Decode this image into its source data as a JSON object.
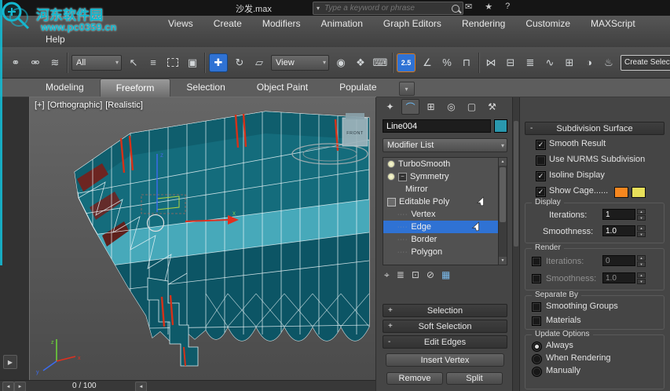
{
  "watermark": {
    "site_name": "河东软件园",
    "site_url": "www.pc0359.cn"
  },
  "title_bar": {
    "document_title": "沙发.max",
    "search_placeholder": "Type a keyword or phrase",
    "right_icons": [
      {
        "name": "communication-center-icon",
        "glyph": "✉"
      },
      {
        "name": "favorites-icon",
        "glyph": "★"
      },
      {
        "name": "help-icon",
        "glyph": "?"
      }
    ]
  },
  "menu": {
    "row1": [
      "Views",
      "Create",
      "Modifiers",
      "Animation",
      "Graph Editors",
      "Rendering",
      "Customize",
      "MAXScript"
    ],
    "row2": [
      "Help"
    ]
  },
  "toolbar": {
    "selection_filter_value": "All",
    "coordinate_system_value": "View",
    "snap_toggle_value": "2.5",
    "create_selection_set_label": "Create Selection S",
    "icons": [
      {
        "name": "select-and-link-icon",
        "glyph": "⚭"
      },
      {
        "name": "unlink-selection-icon",
        "glyph": "⚮"
      },
      {
        "name": "bind-to-space-warp-icon",
        "glyph": "≋"
      },
      {
        "name": "select-object-icon",
        "glyph": "↖"
      },
      {
        "name": "select-by-name-icon",
        "glyph": "≡"
      },
      {
        "name": "rectangular-selection-region-icon",
        "glyph": ""
      },
      {
        "name": "window-crossing-toggle-icon",
        "glyph": "▣"
      },
      {
        "name": "select-and-move-icon",
        "glyph": "✚",
        "active": true
      },
      {
        "name": "select-and-rotate-icon",
        "glyph": "↻"
      },
      {
        "name": "select-and-uniform-scale-icon",
        "glyph": "▱"
      },
      {
        "name": "use-pivot-point-center-icon",
        "glyph": "◉"
      },
      {
        "name": "select-and-manipulate-icon",
        "glyph": "❖"
      },
      {
        "name": "keyboard-shortcut-override-icon",
        "glyph": "⌨"
      },
      {
        "name": "angle-snap-toggle-icon",
        "glyph": "∠"
      },
      {
        "name": "percent-snap-toggle-icon",
        "glyph": "%"
      },
      {
        "name": "spinner-snap-toggle-icon",
        "glyph": "⊓"
      },
      {
        "name": "mirror-icon",
        "glyph": "⋈"
      },
      {
        "name": "align-icon",
        "glyph": "⊟"
      },
      {
        "name": "layer-manager-icon",
        "glyph": "≣"
      },
      {
        "name": "curve-editor-icon",
        "glyph": "∿"
      },
      {
        "name": "schematic-view-icon",
        "glyph": "⊞"
      },
      {
        "name": "material-editor-icon",
        "glyph": "◑"
      },
      {
        "name": "render-setup-icon",
        "glyph": "♨"
      }
    ]
  },
  "ribbon": {
    "tabs": [
      {
        "label": "Modeling",
        "active": false
      },
      {
        "label": "Freeform",
        "active": true
      },
      {
        "label": "Selection",
        "active": false
      },
      {
        "label": "Object Paint",
        "active": false
      },
      {
        "label": "Populate",
        "active": false
      }
    ]
  },
  "viewport": {
    "labels": {
      "expand": "[+]",
      "view": "[Orthographic]",
      "shading": "[Realistic]"
    },
    "front_label": "FRONT",
    "axis": {
      "x": "x",
      "y": "y",
      "z": "z"
    }
  },
  "timeline": {
    "frame_display": "0 / 100"
  },
  "command_panel": {
    "tabs": [
      {
        "name": "create-tab",
        "glyph": "✦",
        "active": false
      },
      {
        "name": "modify-tab",
        "glyph": "⌒",
        "active": true
      },
      {
        "name": "hierarchy-tab",
        "glyph": "⊞",
        "active": false
      },
      {
        "name": "motion-tab",
        "glyph": "◎",
        "active": false
      },
      {
        "name": "display-tab",
        "glyph": "▢",
        "active": false
      },
      {
        "name": "utilities-tab",
        "glyph": "⚒",
        "active": false
      }
    ],
    "object_name": "Line004",
    "object_color": "#2a98ae",
    "modifier_list_label": "Modifier List",
    "stack": [
      {
        "label": "TurboSmooth",
        "selected": false
      },
      {
        "label": "Symmetry",
        "selected": false
      },
      {
        "label": "Mirror",
        "selected": false
      },
      {
        "label": "Editable Poly",
        "selected": false
      },
      {
        "label": "Vertex",
        "selected": false
      },
      {
        "label": "Edge",
        "selected": true
      },
      {
        "label": "Border",
        "selected": false
      },
      {
        "label": "Polygon",
        "selected": false
      }
    ],
    "stack_toolbar": [
      {
        "name": "pin-stack-icon",
        "glyph": "⌖"
      },
      {
        "name": "show-end-result-icon",
        "glyph": "≣"
      },
      {
        "name": "make-unique-icon",
        "glyph": "⊡"
      },
      {
        "name": "remove-modifier-icon",
        "glyph": "⊘"
      },
      {
        "name": "configure-modifier-sets-icon",
        "glyph": "▦"
      }
    ],
    "rollouts": [
      {
        "label": "Selection",
        "state": "+"
      },
      {
        "label": "Soft Selection",
        "state": "+"
      },
      {
        "label": "Edit Edges",
        "state": "-"
      }
    ],
    "edit_edges_buttons": {
      "insert_vertex": "Insert Vertex",
      "remove": "Remove",
      "split": "Split"
    }
  },
  "subdivision": {
    "collapse_glyph": "-",
    "title": "Subdivision Surface",
    "options": [
      {
        "label": "Smooth Result",
        "checked": true
      },
      {
        "label": "Use NURMS Subdivision",
        "checked": false
      },
      {
        "label": "Isoline Display",
        "checked": true
      },
      {
        "label": "Show Cage......",
        "checked": true
      }
    ],
    "cage_colors": [
      "#f6871f",
      "#e8e05a"
    ],
    "display": {
      "title": "Display",
      "iterations_label": "Iterations:",
      "iterations_value": "1",
      "smoothness_label": "Smoothness:",
      "smoothness_value": "1.0"
    },
    "render": {
      "title": "Render",
      "iterations_label": "Iterations:",
      "iterations_value": "0",
      "smoothness_label": "Smoothness:",
      "smoothness_value": "1.0",
      "iterations_checked": false,
      "smoothness_checked": false
    },
    "separate_by": {
      "title": "Separate By",
      "options": [
        {
          "label": "Smoothing Groups",
          "checked": false
        },
        {
          "label": "Materials",
          "checked": false
        }
      ]
    },
    "update_options": {
      "title": "Update Options",
      "options": [
        {
          "label": "Always",
          "selected": true
        },
        {
          "label": "When Rendering",
          "selected": false
        },
        {
          "label": "Manually",
          "selected": false
        }
      ]
    }
  },
  "glyphs": {
    "chevron_down": "▾",
    "up_arrow": "▲",
    "down_arrow": "▼",
    "left": "◄",
    "right": "►",
    "play": "▶",
    "minus": "−",
    "dots": "····"
  },
  "colors": {
    "selection_blue": "#2f72d4",
    "watermark_teal": "#12b6cc",
    "mesh_teal": "#15707f"
  }
}
